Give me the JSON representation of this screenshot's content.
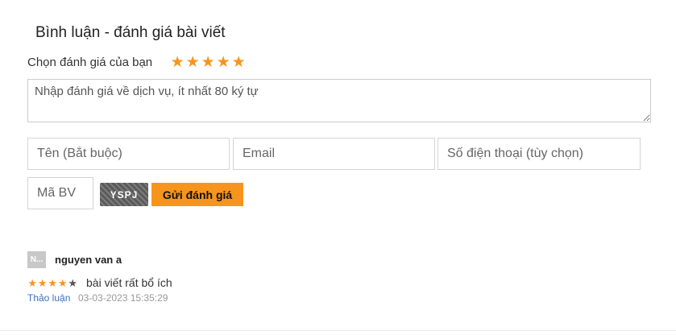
{
  "section": {
    "title": "Bình luận - đánh giá bài viết"
  },
  "rating": {
    "label": "Chọn đánh giá của bạn",
    "stars": [
      "★",
      "★",
      "★",
      "★",
      "★"
    ],
    "selected": 5,
    "max": 5
  },
  "form": {
    "review_placeholder": "Nhập đánh giá về dịch vụ, ít nhất 80 ký tự",
    "name_placeholder": "Tên (Bắt buộc)",
    "email_placeholder": "Email",
    "phone_placeholder": "Số điện thoại (tùy chọn)",
    "captcha_placeholder": "Mã BV",
    "captcha_code": "YSPJ",
    "submit_label": "Gửi đánh giá"
  },
  "comments": [
    {
      "avatar_text": "N...",
      "author": "nguyen van a",
      "rating": 4,
      "max_rating": 5,
      "text": "bài viết rất bổ ích",
      "reply_label": "Thảo luận",
      "timestamp": "03-03-2023 15:35:29"
    }
  ],
  "colors": {
    "accent": "#f7941d",
    "link": "#3a6fc4",
    "muted": "#999999"
  }
}
